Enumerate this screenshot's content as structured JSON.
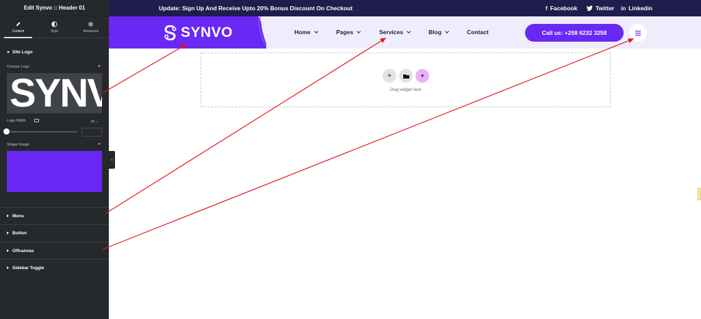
{
  "editor": {
    "title": "Edit Synvo :: Header 01",
    "tabs": [
      {
        "label": "Content",
        "icon": "pencil-icon"
      },
      {
        "label": "Style",
        "icon": "half-circle-icon"
      },
      {
        "label": "Advanced",
        "icon": "gear-icon"
      }
    ],
    "section_site_logo": "Site Logo",
    "choose_logo_label": "Choose Logo",
    "logo_preview_text": "SYNV",
    "logo_width_label": "Logo Width",
    "logo_width_unit": "px",
    "logo_width_value": "",
    "shape_image_label": "Shape Image",
    "shape_color": "#6a28f5",
    "accordions": [
      "Menu",
      "Button",
      "Offcanvas",
      "Sidebar Toggle"
    ]
  },
  "site": {
    "topbar_text": "Update: Sign Up And Receive Upto 20% Bonus Discount On Checkout",
    "social": [
      {
        "icon": "facebook-icon",
        "glyph": "f",
        "label": "Facebook"
      },
      {
        "icon": "twitter-icon",
        "glyph": "🐦",
        "label": "Twitter"
      },
      {
        "icon": "linkedin-icon",
        "glyph": "in",
        "label": "Linkedin"
      }
    ],
    "logo_text": "SYNVO",
    "nav": [
      "Home",
      "Pages",
      "Services",
      "Blog",
      "Contact"
    ],
    "cta_label": "Call us: +258 6232 3258",
    "dropzone_text": "Drag widget here"
  },
  "colors": {
    "brand_purple": "#6a28f5",
    "topbar_navy": "#211c4e",
    "header_bg": "#efedfb",
    "panel_bg": "#26292c",
    "arrow_red": "#e8141c"
  }
}
